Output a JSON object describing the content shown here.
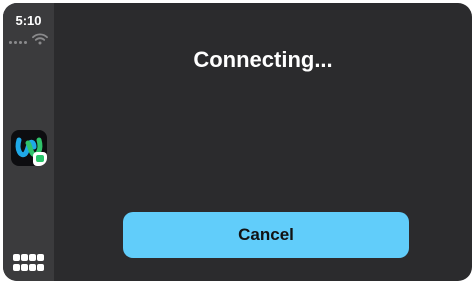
{
  "status_bar": {
    "time": "5:10",
    "signal_icon": "cellular-dots-icon",
    "wifi_icon": "wifi-icon"
  },
  "sidebar": {
    "apps": [
      {
        "icon": "webex-app-icon"
      }
    ],
    "home_icon": "app-grid-icon"
  },
  "main": {
    "title": "Connecting...",
    "cancel_label": "Cancel"
  },
  "colors": {
    "background": "#2b2b2d",
    "sidebar": "#3b3b3d",
    "button": "#61cdfa",
    "button_text": "#121212",
    "text": "#ffffff"
  }
}
